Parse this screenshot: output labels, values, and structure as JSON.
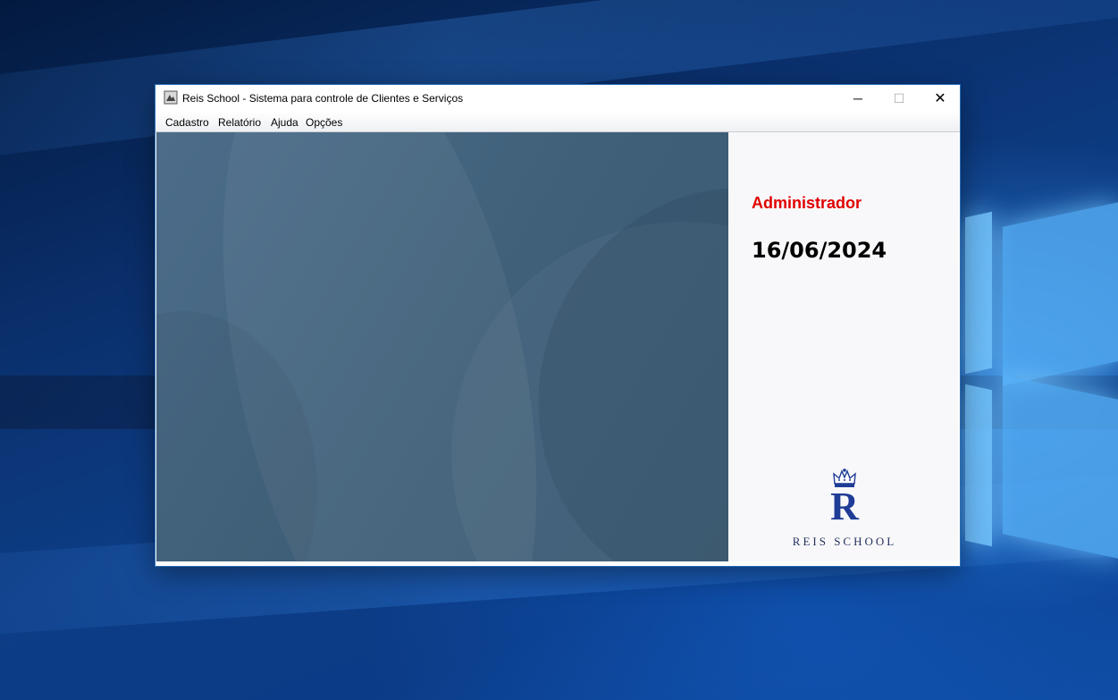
{
  "window": {
    "title": "Reis School - Sistema para controle de Clientes e Serviços",
    "app_icon": "java-app-icon",
    "controls": {
      "minimize": "─",
      "maximize": "☐",
      "close": "✕"
    }
  },
  "menu": {
    "items": [
      {
        "label": "Cadastro"
      },
      {
        "label": "Relatório"
      },
      {
        "label": "Ajuda"
      },
      {
        "label": "Opções"
      }
    ]
  },
  "info": {
    "user": "Administrador",
    "date": "16/06/2024"
  },
  "brand": {
    "initial": "R",
    "name": "REIS SCHOOL",
    "crown_icon": "crown-icon"
  },
  "colors": {
    "user_label": "#e00000",
    "brand_blue": "#1f3c96",
    "panel_bg": "#44657f"
  }
}
